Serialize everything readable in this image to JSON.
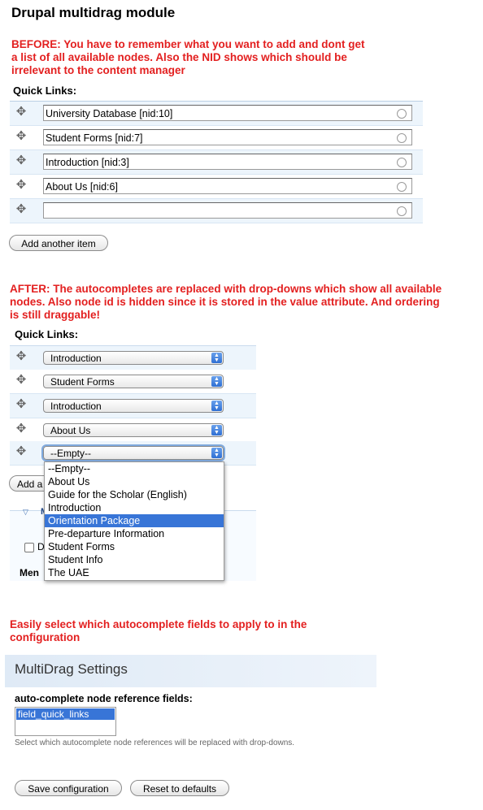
{
  "title": "Drupal multidrag module",
  "before": {
    "text_lines": [
      "BEFORE: You have to remember what you want to add and dont get",
      "a list of all available nodes. Also the NID shows which should be",
      "irrelevant to the content manager"
    ],
    "quick_links_label": "Quick Links:",
    "items": [
      "University Database [nid:10]",
      "Student Forms [nid:7]",
      "Introduction [nid:3]",
      "About Us [nid:6]",
      ""
    ],
    "add_button": "Add another item"
  },
  "after": {
    "text_lines": [
      "AFTER: The autocompletes are replaced with drop-downs which show all available",
      "nodes. Also node id is hidden since it is stored in the value attribute. And ordering",
      "is still draggable!"
    ],
    "quick_links_label": "Quick Links:",
    "selects": [
      "Introduction",
      "Student Forms",
      "Introduction",
      "About Us",
      "--Empty--"
    ],
    "add_button_partial": "Add a",
    "dropdown_options": [
      "--Empty--",
      "About Us",
      "Guide for the Scholar (English)",
      "Introduction",
      "Orientation Package",
      "Pre-departure Information",
      "Student Forms",
      "Student Info",
      "The UAE"
    ],
    "highlighted_option": "Orientation Package",
    "hidden_fragments": {
      "checkbox_letter": "D",
      "menu_partial": "Men",
      "legend_partial": "M"
    }
  },
  "config_text_lines": [
    "Easily select which autocomplete fields to apply to in the",
    "configuration"
  ],
  "settings": {
    "title": "MultiDrag Settings",
    "field_label": "auto-complete node reference fields:",
    "listbox_items": [
      "field_quick_links"
    ],
    "description": "Select which autocomplete node references will be replaced with drop-downs.",
    "save_button": "Save configuration",
    "reset_button": "Reset to defaults"
  },
  "icons": {
    "drag_handle": "drag-handle-icon",
    "throbber": "autocomplete-throbber-icon",
    "select_arrow": "select-arrows-icon"
  },
  "colors": {
    "annotation_red": "#e32020",
    "table_stripe": "#edf5fc",
    "highlight_blue": "#3875d7"
  }
}
